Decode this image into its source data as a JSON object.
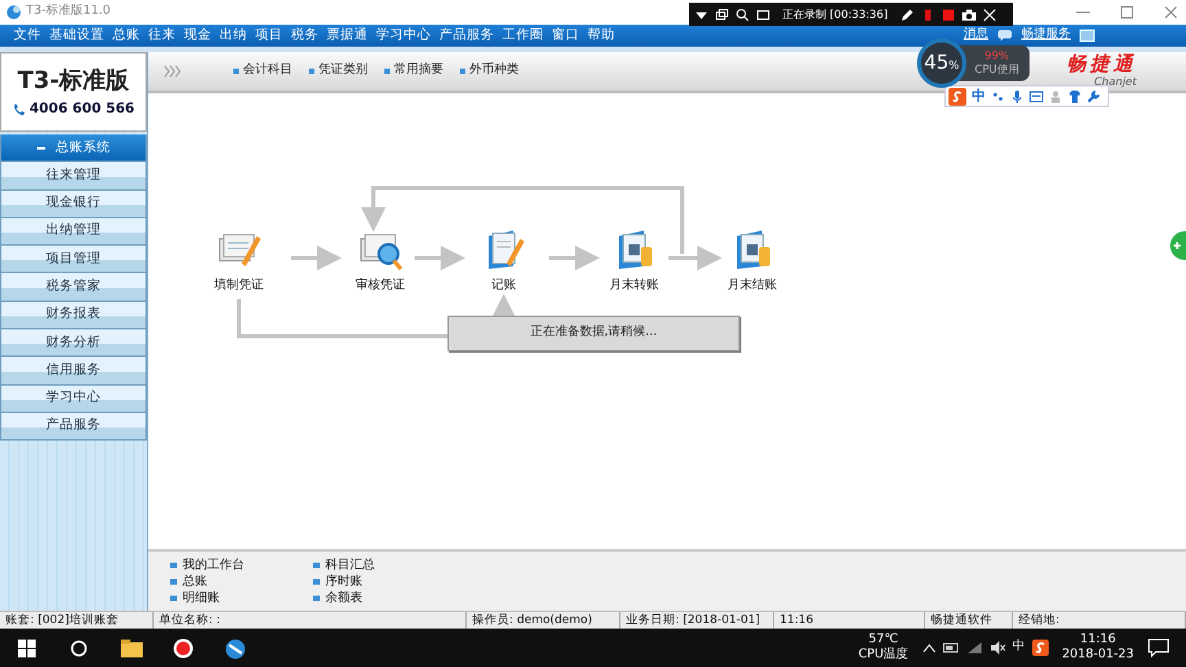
{
  "window": {
    "title": "T3-标准版11.0"
  },
  "recorder": {
    "status": "正在录制 [00:33:36]"
  },
  "menu": [
    "文件",
    "基础设置",
    "总账",
    "往来",
    "现金",
    "出纳",
    "项目",
    "税务",
    "票据通",
    "学习中心",
    "产品服务",
    "工作圈",
    "窗口",
    "帮助"
  ],
  "header_links": [
    "消息",
    "畅捷服务"
  ],
  "brand": {
    "product": "T3-标准版",
    "phone": "4006 600 566",
    "vendor": "畅捷通",
    "vendor_latin": "Chanjet"
  },
  "toolbar_links": [
    "会计科目",
    "凭证类别",
    "常用摘要",
    "外币种类"
  ],
  "cpu_widget": {
    "percent": "45",
    "unit": "%",
    "peak": "99%",
    "label": "CPU使用"
  },
  "ime_bar": {
    "mode": "中"
  },
  "sidebar": [
    {
      "label": "总账系统",
      "selected": true
    },
    {
      "label": "往来管理",
      "selected": false
    },
    {
      "label": "现金银行",
      "selected": false
    },
    {
      "label": "出纳管理",
      "selected": false
    },
    {
      "label": "项目管理",
      "selected": false
    },
    {
      "label": "税务管家",
      "selected": false
    },
    {
      "label": "财务报表",
      "selected": false
    },
    {
      "label": "财务分析",
      "selected": false
    },
    {
      "label": "信用服务",
      "selected": false
    },
    {
      "label": "学习中心",
      "selected": false
    },
    {
      "label": "产品服务",
      "selected": false
    }
  ],
  "flow": [
    {
      "label": "填制凭证",
      "kind": "form"
    },
    {
      "label": "审核凭证",
      "kind": "review"
    },
    {
      "label": "记账",
      "kind": "ledger"
    },
    {
      "label": "月末转账",
      "kind": "calendar"
    },
    {
      "label": "月末结账",
      "kind": "calendar"
    }
  ],
  "loading_message": "正在准备数据,请稍候...",
  "quick_links": [
    [
      "我的工作台",
      "总账",
      "明细账"
    ],
    [
      "科目汇总",
      "序时账",
      "余额表"
    ]
  ],
  "status_bar": [
    "账套: [002]培训账套",
    "单位名称: :",
    "操作员: demo(demo)",
    "业务日期: [2018-01-01]",
    "11:16",
    "畅捷通软件",
    "经销地:"
  ],
  "taskbar": {
    "temperature": "57℃",
    "temperature_label": "CPU温度",
    "ime": "中",
    "time": "11:16",
    "date": "2018-01-23"
  }
}
